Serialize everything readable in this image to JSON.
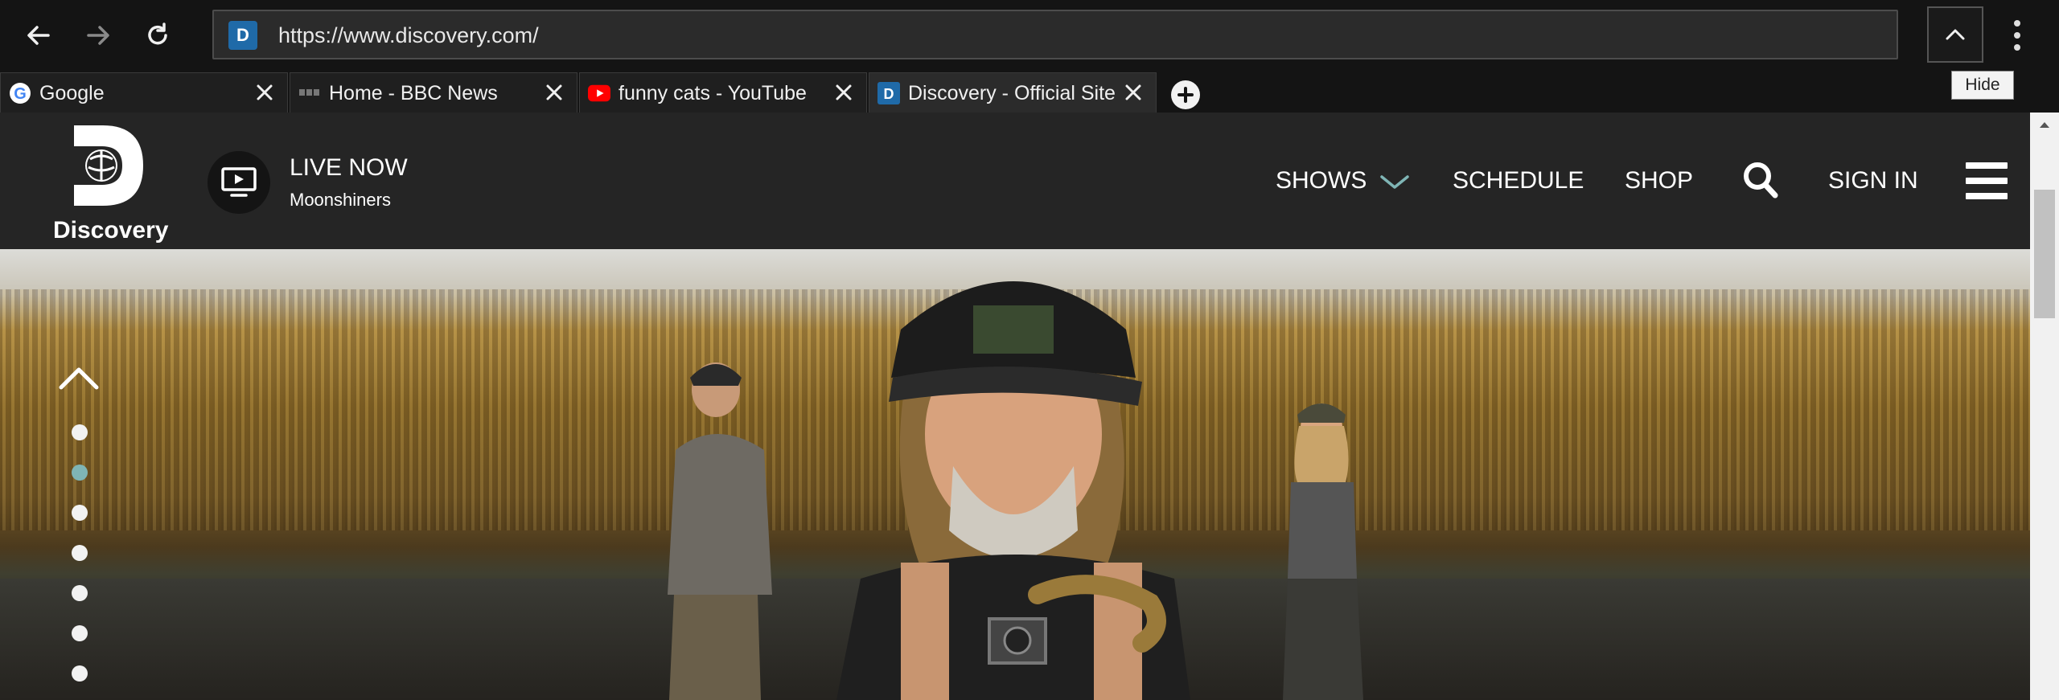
{
  "browser": {
    "url": "https://www.discovery.com/",
    "hide_tooltip": "Hide",
    "tabs": [
      {
        "title": "Google",
        "favicon": "google-icon",
        "active": false
      },
      {
        "title": "Home - BBC News",
        "favicon": "bbc-icon",
        "active": false
      },
      {
        "title": "funny cats - YouTube",
        "favicon": "youtube-icon",
        "active": false
      },
      {
        "title": "Discovery - Official Site",
        "favicon": "discovery-icon",
        "active": true
      }
    ]
  },
  "site": {
    "logo_text": "Discovery",
    "live": {
      "title": "LIVE NOW",
      "subtitle": "Moonshiners"
    },
    "nav": {
      "shows": "SHOWS",
      "schedule": "SCHEDULE",
      "shop": "SHOP",
      "sign_in": "SIGN IN"
    },
    "accent_color": "#7fb5b5",
    "carousel": {
      "dot_count": 7,
      "active_index": 1
    }
  }
}
